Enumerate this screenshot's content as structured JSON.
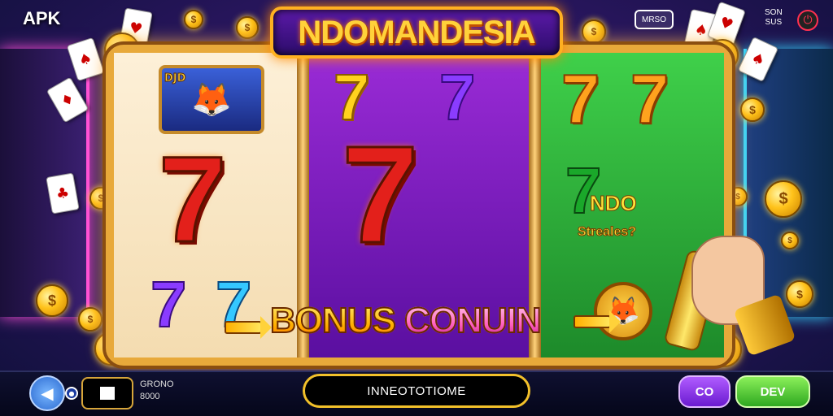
{
  "header": {
    "apk_label": "APK",
    "title": "NDOMANDESIA",
    "chat_icon_text": "MRSO",
    "son_line1": "SON",
    "son_line2": "SUS"
  },
  "reels": {
    "reel1": {
      "mascot_badge": "DJD",
      "top_symbol": "7",
      "bottom_symbols": [
        "7",
        "7"
      ]
    },
    "reel2": {
      "top_symbols": [
        "7",
        "7"
      ],
      "center_symbol": "7"
    },
    "reel3": {
      "top_symbols": [
        "7",
        "7"
      ],
      "logo_main": "NDO",
      "logo_sub": "Streales?"
    }
  },
  "bonus": {
    "word1": "BONUS",
    "word2": "CONUIN"
  },
  "bottom_bar": {
    "stat_line1": "GRONO",
    "stat_line2": "8000",
    "center_pill_text": "INNEOTOTIOME",
    "purple_button": "CO",
    "green_button": "DEV"
  },
  "colors": {
    "accent_gold": "#f2c02a",
    "reel1_bg": "#fdf0d8",
    "reel2_bg": "#9a2bd6",
    "reel3_bg": "#3fd04a"
  },
  "icons": [
    "back-arrow-icon",
    "power-icon",
    "chat-icon",
    "playing-card-icon",
    "coin-icon",
    "fox-mascot-icon",
    "hand-icon"
  ]
}
